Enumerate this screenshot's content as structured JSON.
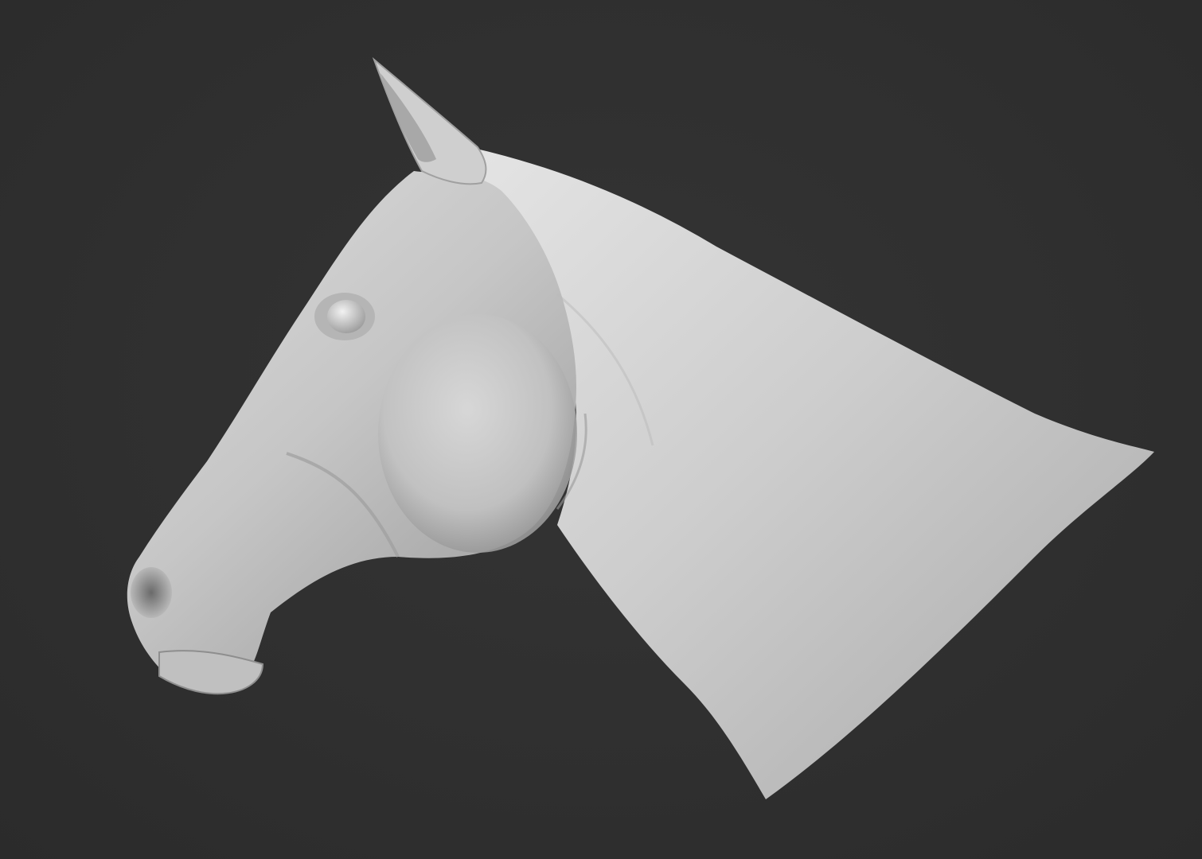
{
  "scene": {
    "background_color": "#2f2f2f",
    "subject": "horse-head-sculpt",
    "material_color": "#cfcfcf"
  }
}
